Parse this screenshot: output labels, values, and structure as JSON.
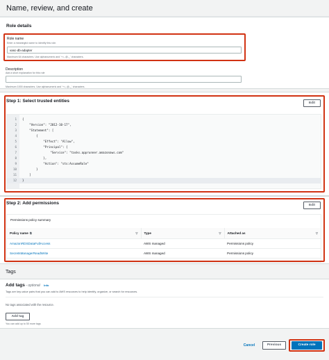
{
  "page": {
    "title": "Name, review, and create"
  },
  "role_details": {
    "header": "Role details",
    "role_name": {
      "label": "Role name",
      "hint": "Enter a meaningful name to identify this role.",
      "value": "vasc-db-adapter",
      "constraint": "Maximum 64 characters. Use alphanumeric and '+=,.@-_' characters."
    },
    "description": {
      "label": "Description",
      "hint": "Add a short explanation for this role",
      "value": "",
      "constraint": "Maximum 1000 characters. Use alphanumeric and '+=,.@-_' characters."
    }
  },
  "step1": {
    "header": "Step 1: Select trusted entities",
    "edit_label": "Edit",
    "code_lines": [
      {
        "n": "1",
        "t": "{"
      },
      {
        "n": "2",
        "t": "    \"Version\": \"2012-10-17\","
      },
      {
        "n": "3",
        "t": "    \"Statement\": ["
      },
      {
        "n": "4",
        "t": "        {"
      },
      {
        "n": "5",
        "t": "            \"Effect\": \"Allow\","
      },
      {
        "n": "6",
        "t": "            \"Principal\": {"
      },
      {
        "n": "7",
        "t": "                \"Service\": \"tasks.apprunner.amazonaws.com\""
      },
      {
        "n": "8",
        "t": "            },"
      },
      {
        "n": "9",
        "t": "            \"Action\": \"sts:AssumeRole\""
      },
      {
        "n": "10",
        "t": "        }"
      },
      {
        "n": "11",
        "t": "    ]"
      },
      {
        "n": "12",
        "t": "}"
      }
    ]
  },
  "step2": {
    "header": "Step 2: Add permissions",
    "edit_label": "Edit",
    "summary_label": "Permissions policy summary",
    "columns": [
      "Policy name",
      "Type",
      "Attached as"
    ],
    "rows": [
      {
        "name": "AmazonRDSDataFullAccess",
        "type": "AWS managed",
        "attached": "Permissions policy"
      },
      {
        "name": "SecretsManagerReadWrite",
        "type": "AWS managed",
        "attached": "Permissions policy"
      }
    ]
  },
  "tags": {
    "section_title": "Tags",
    "add_tags_title": "Add tags",
    "optional_label": "- optional",
    "info_label": "Info",
    "description": "Tags are key-value pairs that you can add to AWS resources to help identify, organize, or search for resources.",
    "empty_text": "No tags associated with the resource.",
    "add_tag_label": "Add tag",
    "limit_text": "You can add up to 50 more tags"
  },
  "footer": {
    "cancel_label": "Cancel",
    "previous_label": "Previous",
    "create_label": "Create role"
  },
  "colors": {
    "highlight": "#d13212",
    "primary": "#0073bb",
    "link": "#0073bb"
  }
}
